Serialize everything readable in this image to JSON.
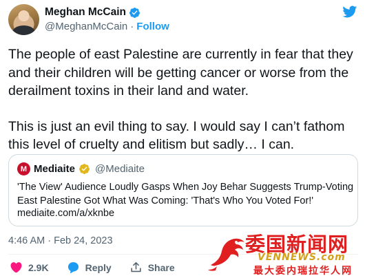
{
  "author": {
    "name": "Meghan McCain",
    "handle": "@MeghanMcCain",
    "separator": "·",
    "follow_label": "Follow"
  },
  "tweet": {
    "paragraphs": [
      "The people of east Palestine are currently in fear that they and their children will be getting cancer or worse from the derailment toxins in their land and water.",
      "This is just an evil thing to say. I would say I can’t fathom this level of cruelty and elitism but sadly… I can."
    ]
  },
  "quote": {
    "logo_letter": "M",
    "name": "Mediaite",
    "handle": "@Mediaite",
    "text": "'The View' Audience Loudly Gasps When Joy Behar Suggests Trump-Voting East Palestine Got What Was Coming: 'That's Who You Voted For!'",
    "link": "mediaite.com/a/xknbe"
  },
  "timestamp": "4:46 AM · Feb 24, 2023",
  "actions": {
    "like_count": "2.9K",
    "reply_label": "Reply",
    "share_label": "Share"
  },
  "watermark": {
    "cn": "委国新闻网",
    "en": "VENNEWS.com",
    "sub": "最大委内瑞拉华人网"
  },
  "colors": {
    "accent": "#1d9bf0",
    "like": "#f91880",
    "watermark_red": "#e02020"
  }
}
